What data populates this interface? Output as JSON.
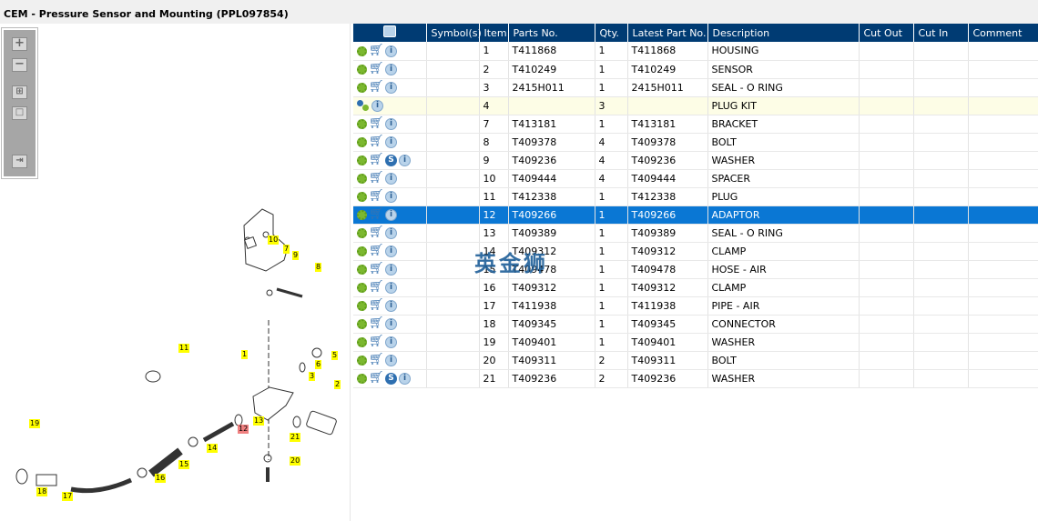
{
  "window": {
    "title": "CEM - Pressure Sensor and Mounting (PPL097854)"
  },
  "toolbar": {
    "zoom_in": "+",
    "zoom_out": "−",
    "fit": "⊞",
    "actual": "□",
    "export": "⇥"
  },
  "diagram": {
    "callouts": [
      "10",
      "7",
      "9",
      "8",
      "11",
      "1",
      "5",
      "6",
      "3",
      "2",
      "13",
      "12",
      "21",
      "14",
      "19",
      "15",
      "20",
      "16",
      "18",
      "17"
    ],
    "highlighted": "12"
  },
  "table": {
    "columns": [
      "",
      "Symbol(s)",
      "Item",
      "Parts No.",
      "Qty.",
      "Latest Part No.",
      "Description",
      "Cut Out",
      "Cut In",
      "Comment"
    ],
    "rows": [
      {
        "icons": [
          "gear",
          "cart",
          "info"
        ],
        "item": "1",
        "part": "T411868",
        "qty": "1",
        "latest": "T411868",
        "desc": "HOUSING"
      },
      {
        "icons": [
          "gear",
          "cart",
          "info"
        ],
        "item": "2",
        "part": "T410249",
        "qty": "1",
        "latest": "T410249",
        "desc": "SENSOR"
      },
      {
        "icons": [
          "gear",
          "cart",
          "info"
        ],
        "item": "3",
        "part": "2415H011",
        "qty": "1",
        "latest": "2415H011",
        "desc": "SEAL - O RING"
      },
      {
        "icons": [
          "gears",
          "info"
        ],
        "item": "4",
        "part": "",
        "qty": "3",
        "latest": "",
        "desc": "PLUG KIT",
        "kit": true
      },
      {
        "icons": [
          "gear",
          "cart",
          "info"
        ],
        "item": "7",
        "part": "T413181",
        "qty": "1",
        "latest": "T413181",
        "desc": "BRACKET"
      },
      {
        "icons": [
          "gear",
          "cart",
          "info"
        ],
        "item": "8",
        "part": "T409378",
        "qty": "4",
        "latest": "T409378",
        "desc": "BOLT"
      },
      {
        "icons": [
          "gear",
          "cart",
          "s",
          "info"
        ],
        "item": "9",
        "part": "T409236",
        "qty": "4",
        "latest": "T409236",
        "desc": "WASHER"
      },
      {
        "icons": [
          "gear",
          "cart",
          "info"
        ],
        "item": "10",
        "part": "T409444",
        "qty": "4",
        "latest": "T409444",
        "desc": "SPACER"
      },
      {
        "icons": [
          "gear",
          "cart",
          "info"
        ],
        "item": "11",
        "part": "T412338",
        "qty": "1",
        "latest": "T412338",
        "desc": "PLUG"
      },
      {
        "icons": [
          "gear",
          "cart",
          "info"
        ],
        "item": "12",
        "part": "T409266",
        "qty": "1",
        "latest": "T409266",
        "desc": "ADAPTOR",
        "selected": true
      },
      {
        "icons": [
          "gear",
          "cart",
          "info"
        ],
        "item": "13",
        "part": "T409389",
        "qty": "1",
        "latest": "T409389",
        "desc": "SEAL - O RING"
      },
      {
        "icons": [
          "gear",
          "cart",
          "info"
        ],
        "item": "14",
        "part": "T409312",
        "qty": "1",
        "latest": "T409312",
        "desc": "CLAMP"
      },
      {
        "icons": [
          "gear",
          "cart",
          "info"
        ],
        "item": "15",
        "part": "T409478",
        "qty": "1",
        "latest": "T409478",
        "desc": "HOSE - AIR"
      },
      {
        "icons": [
          "gear",
          "cart",
          "info"
        ],
        "item": "16",
        "part": "T409312",
        "qty": "1",
        "latest": "T409312",
        "desc": "CLAMP"
      },
      {
        "icons": [
          "gear",
          "cart",
          "info"
        ],
        "item": "17",
        "part": "T411938",
        "qty": "1",
        "latest": "T411938",
        "desc": "PIPE - AIR"
      },
      {
        "icons": [
          "gear",
          "cart",
          "info"
        ],
        "item": "18",
        "part": "T409345",
        "qty": "1",
        "latest": "T409345",
        "desc": "CONNECTOR"
      },
      {
        "icons": [
          "gear",
          "cart",
          "info"
        ],
        "item": "19",
        "part": "T409401",
        "qty": "1",
        "latest": "T409401",
        "desc": "WASHER"
      },
      {
        "icons": [
          "gear",
          "cart",
          "info"
        ],
        "item": "20",
        "part": "T409311",
        "qty": "2",
        "latest": "T409311",
        "desc": "BOLT"
      },
      {
        "icons": [
          "gear",
          "cart",
          "s",
          "info"
        ],
        "item": "21",
        "part": "T409236",
        "qty": "2",
        "latest": "T409236",
        "desc": "WASHER"
      }
    ]
  },
  "watermark": "英金狮"
}
